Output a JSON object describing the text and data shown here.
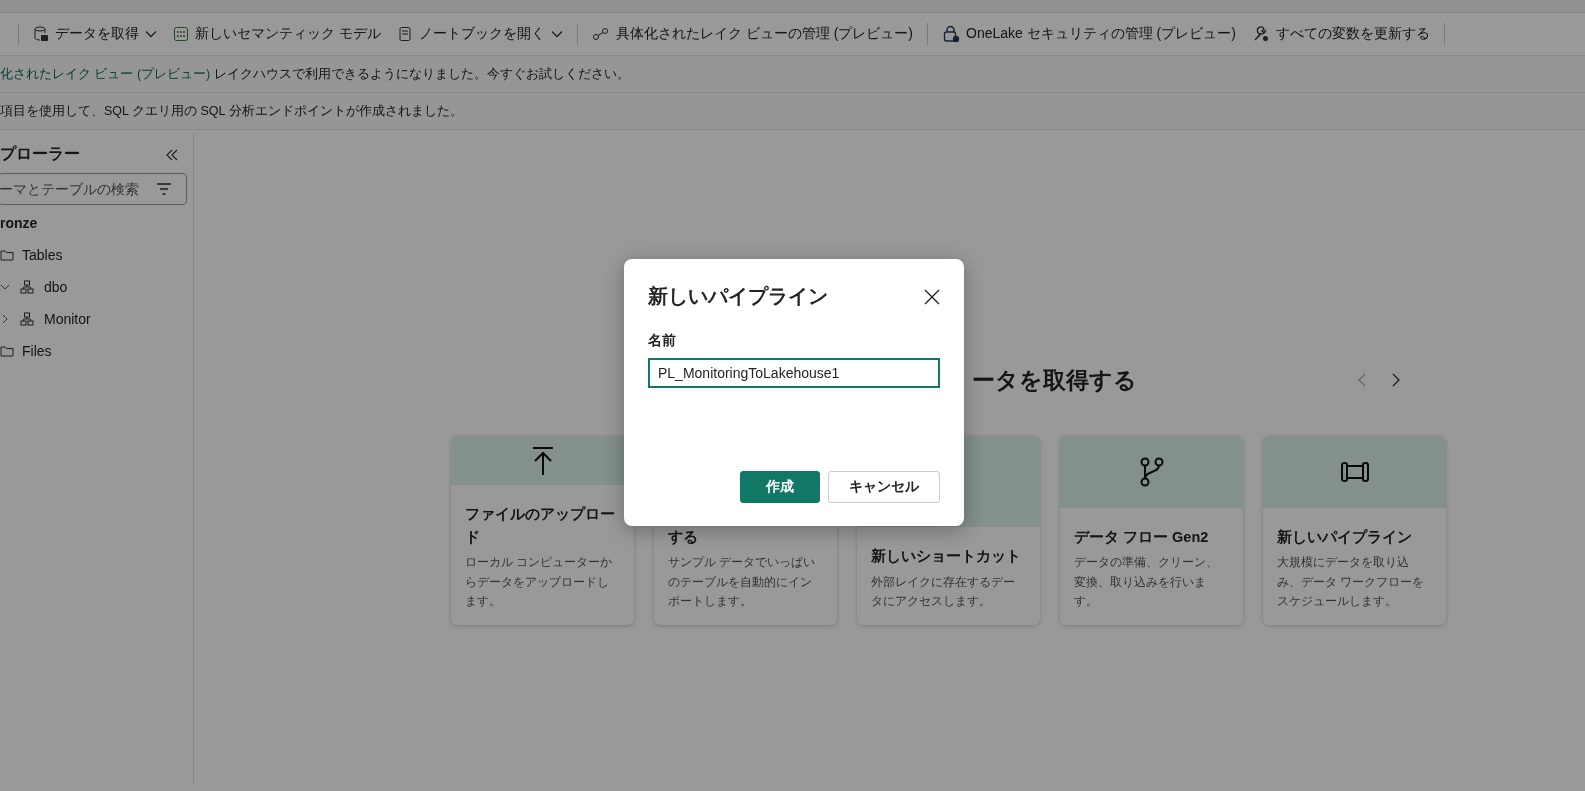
{
  "toolbar": {
    "items": [
      {
        "label": "データを取得",
        "dropdown": true,
        "separator_before": true
      },
      {
        "label": "新しいセマンティック モデル",
        "dropdown": false,
        "separator_before": false
      },
      {
        "label": "ノートブックを開く",
        "dropdown": true,
        "separator_before": false
      },
      {
        "label": "具体化されたレイク ビューの管理 (プレビュー)",
        "dropdown": false,
        "separator_before": true
      },
      {
        "label": "OneLake セキュリティの管理 (プレビュー)",
        "dropdown": false,
        "separator_before": true
      },
      {
        "label": "すべての変数を更新する",
        "dropdown": false,
        "separator_before": false
      }
    ]
  },
  "banners": [
    {
      "link": "化されたレイク ビュー (プレビュー)",
      "text": "レイクハウスで利用できるようになりました。今すぐお試しください。"
    },
    {
      "text": "項目を使用して、SQL クエリ用の SQL 分析エンドポイントが作成されました。"
    }
  ],
  "explorer": {
    "title": "プローラー",
    "search": {
      "placeholder": "ーマとテーブルの検索"
    },
    "tree": [
      {
        "label": "ronze",
        "kind": "lakehouse",
        "children": [
          {
            "label": "Tables",
            "kind": "folder",
            "children": [
              {
                "label": "dbo",
                "kind": "schema",
                "expanded": true
              },
              {
                "label": "Monitor",
                "kind": "schema",
                "expanded": false
              }
            ]
          },
          {
            "label": "Files",
            "kind": "folder"
          }
        ]
      }
    ]
  },
  "get_data": {
    "heading": "ータを取得する",
    "cards": [
      {
        "kind": "upload",
        "title": "ファイルのアップロード",
        "description": "ローカル コンピューターからデータをアップロードします。"
      },
      {
        "kind": "sample",
        "title": "する",
        "description": "サンプル データでいっぱいのテーブルを自動的にインポートします。"
      },
      {
        "kind": "shortcut",
        "title": "新しいショートカット",
        "description": "外部レイクに存在するデータにアクセスします。"
      },
      {
        "kind": "dataflow",
        "title": "データ フロー Gen2",
        "description": "データの準備、クリーン、変換、取り込みを行います。"
      },
      {
        "kind": "pipeline",
        "title": "新しいパイプライン",
        "description": "大規模にデータを取り込み、データ ワークフローをスケジュールします。"
      }
    ]
  },
  "dialog": {
    "title": "新しいパイプライン",
    "field_label": "名前",
    "name_value": "PL_MonitoringToLakehouse1",
    "buttons": [
      {
        "label": "作成",
        "kind": "primary"
      },
      {
        "label": "キャンセル",
        "kind": "secondary"
      }
    ]
  }
}
